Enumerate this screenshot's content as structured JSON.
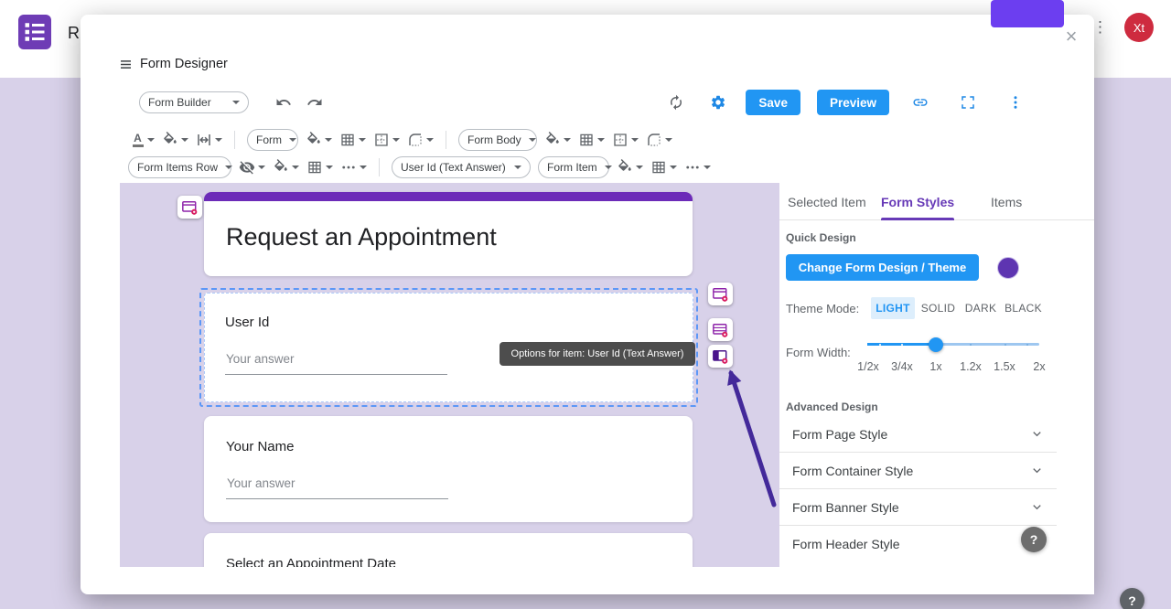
{
  "page": {
    "background_text": "R",
    "avatar": "Xt",
    "more_icon": "⋮",
    "help": "?"
  },
  "modal": {
    "title": "Form Designer",
    "close": "×"
  },
  "toolbar": {
    "builder": "Form Builder",
    "save": "Save",
    "preview": "Preview",
    "font_letter": "A",
    "form": "Form",
    "form_body": "Form Body",
    "form_items_row": "Form Items Row",
    "item": "User Id (Text Answer)",
    "form_item": "Form Item"
  },
  "canvas": {
    "form_title": "Request an Appointment",
    "tooltip": "Options for item: User Id (Text Answer)",
    "fields": [
      {
        "label": "User Id",
        "placeholder": "Your answer",
        "selected": true
      },
      {
        "label": "Your Name",
        "placeholder": "Your answer",
        "selected": false
      },
      {
        "label": "Select an Appointment Date",
        "selected": false
      }
    ]
  },
  "panel": {
    "tabs": [
      {
        "label": "Selected Item",
        "active": false
      },
      {
        "label": "Form Styles",
        "active": true
      },
      {
        "label": "Items",
        "active": false
      }
    ],
    "quick_design": "Quick Design",
    "change_theme": "Change Form Design / Theme",
    "theme_mode_label": "Theme Mode:",
    "theme_modes": [
      "LIGHT",
      "SOLID",
      "DARK",
      "BLACK"
    ],
    "active_theme_mode": "LIGHT",
    "form_width_label": "Form Width:",
    "width_options": [
      "1/2x",
      "3/4x",
      "1x",
      "1.2x",
      "1.5x",
      "2x"
    ],
    "selected_width": "1x",
    "advanced_design": "Advanced Design",
    "accordions": [
      {
        "label": "Form Page Style"
      },
      {
        "label": "Form Container Style"
      },
      {
        "label": "Form Banner Style"
      },
      {
        "label": "Form Header Style"
      }
    ],
    "help": "?"
  },
  "colors": {
    "accent_blue": "#2196f3",
    "tab_purple": "#673ab7",
    "banner_purple": "#6c2bb8",
    "selection_blue": "#5c97f7",
    "avatar_red": "#ce2b3f",
    "chip_purple": "#6c3ef0",
    "arrow_purple": "#43299a",
    "theme_swatch": "#5e35b1",
    "canvas_lavender": "#d8d1e9"
  }
}
